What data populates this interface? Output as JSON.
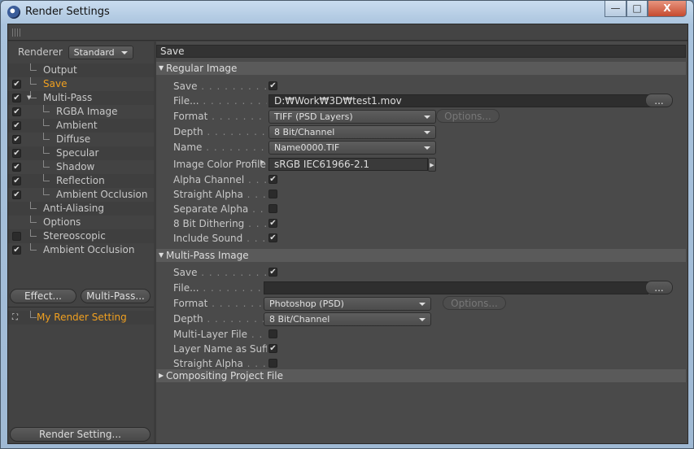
{
  "window": {
    "title": "Render Settings",
    "minimize": "—",
    "maximize": "□",
    "close": "X"
  },
  "left": {
    "renderer_label": "Renderer",
    "renderer_value": "Standard",
    "tree": [
      {
        "label": "Output",
        "checked": null,
        "level": 1,
        "active": false
      },
      {
        "label": "Save",
        "checked": true,
        "level": 1,
        "active": true
      },
      {
        "label": "Multi-Pass",
        "checked": true,
        "level": 1,
        "active": false,
        "expanded": true
      },
      {
        "label": "RGBA Image",
        "checked": true,
        "level": 2
      },
      {
        "label": "Ambient",
        "checked": true,
        "level": 2
      },
      {
        "label": "Diffuse",
        "checked": true,
        "level": 2
      },
      {
        "label": "Specular",
        "checked": true,
        "level": 2
      },
      {
        "label": "Shadow",
        "checked": true,
        "level": 2
      },
      {
        "label": "Reflection",
        "checked": true,
        "level": 2
      },
      {
        "label": "Ambient Occlusion",
        "checked": true,
        "level": 2
      },
      {
        "label": "Anti-Aliasing",
        "checked": null,
        "level": 1
      },
      {
        "label": "Options",
        "checked": null,
        "level": 1
      },
      {
        "label": "Stereoscopic",
        "checked": false,
        "level": 1
      },
      {
        "label": "Ambient Occlusion",
        "checked": true,
        "level": 1
      }
    ],
    "effect_button": "Effect...",
    "multipass_button": "Multi-Pass...",
    "setting_name": "My Render Setting",
    "render_setting_button": "Render Setting..."
  },
  "right": {
    "header": "Save",
    "regular": {
      "title": "Regular Image",
      "rows": [
        {
          "label": "Save",
          "type": "check",
          "checked": true
        },
        {
          "label": "File...",
          "type": "file",
          "value": "D:₩Work₩3D₩test1.mov",
          "button": "..."
        },
        {
          "label": "Format",
          "type": "select",
          "value": "TIFF (PSD Layers)",
          "button": "Options..."
        },
        {
          "label": "Depth",
          "type": "select",
          "value": "8 Bit/Channel"
        },
        {
          "label": "Name",
          "type": "select",
          "value": "Name0000.TIF"
        },
        {
          "label": "Image Color Profile",
          "type": "profile",
          "value": "sRGB IEC61966-2.1"
        },
        {
          "label": "Alpha Channel",
          "type": "check",
          "checked": true
        },
        {
          "label": "Straight Alpha",
          "type": "check",
          "checked": false
        },
        {
          "label": "Separate Alpha",
          "type": "check",
          "checked": false
        },
        {
          "label": "8 Bit Dithering",
          "type": "check",
          "checked": true
        },
        {
          "label": "Include Sound",
          "type": "check",
          "checked": true
        }
      ]
    },
    "multipass": {
      "title": "Multi-Pass Image",
      "rows": [
        {
          "label": "Save",
          "type": "check",
          "checked": true
        },
        {
          "label": "File...",
          "type": "file",
          "value": "",
          "button": "..."
        },
        {
          "label": "Format",
          "type": "select",
          "value": "Photoshop (PSD)",
          "button": "Options..."
        },
        {
          "label": "Depth",
          "type": "select",
          "value": "8 Bit/Channel"
        },
        {
          "label": "Multi-Layer File",
          "type": "check",
          "checked": false
        },
        {
          "label": "Layer Name as Suffix",
          "type": "check",
          "checked": true
        },
        {
          "label": "Straight Alpha",
          "type": "check",
          "checked": false
        }
      ]
    },
    "compositing": {
      "title": "Compositing Project File"
    }
  },
  "colors": {
    "active": "#f0a020",
    "panel": "#4a4a4a",
    "dark": "#3c3c3c"
  }
}
